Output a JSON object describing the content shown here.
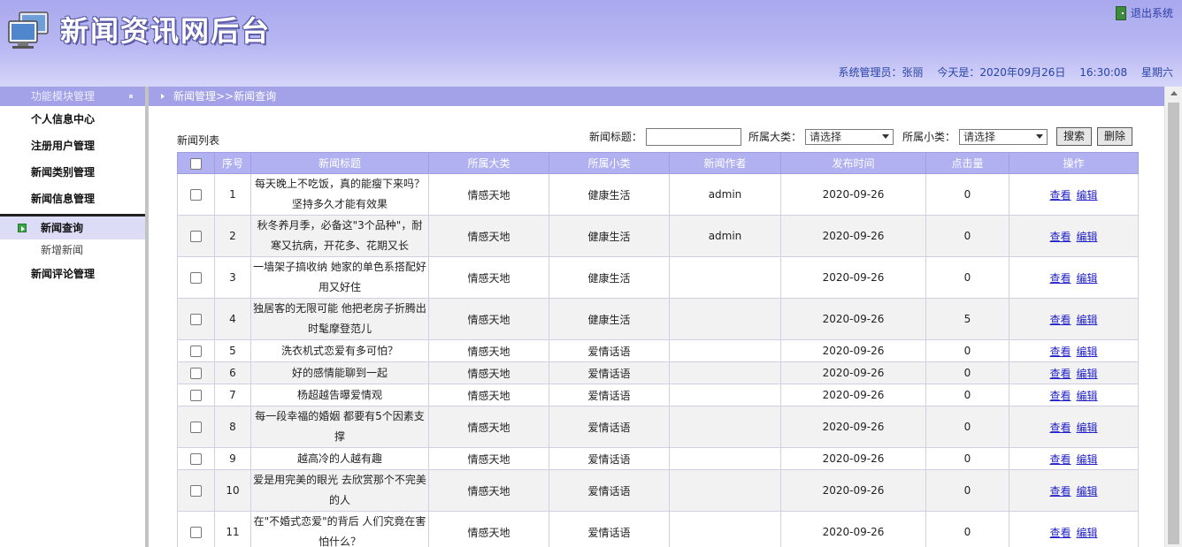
{
  "header": {
    "site_title": "新闻资讯网后台",
    "logout_label": "退出系统",
    "admin_label": "系统管理员：张丽",
    "date_label": "今天是：2020年09月26日",
    "time_label": "16:30:08",
    "weekday_label": "星期六"
  },
  "sidebar": {
    "heading": "功能模块管理",
    "items": [
      {
        "label": "个人信息中心"
      },
      {
        "label": "注册用户管理"
      },
      {
        "label": "新闻类别管理"
      },
      {
        "label": "新闻信息管理"
      }
    ],
    "active_item": "新闻查询",
    "sub_item": "新增新闻",
    "last_item": "新闻评论管理"
  },
  "breadcrumb": "新闻管理>>新闻查询",
  "list": {
    "title": "新闻列表",
    "search_title_label": "新闻标题：",
    "category_label": "所属大类：",
    "category_value": "请选择",
    "subcategory_label": "所属小类：",
    "subcategory_value": "请选择",
    "search_button": "搜索",
    "delete_button": "删除"
  },
  "table": {
    "headers": [
      "序号",
      "新闻标题",
      "所属大类",
      "所属小类",
      "新闻作者",
      "发布时间",
      "点击量",
      "操作"
    ],
    "view_label": "查看",
    "edit_label": "编辑",
    "rows": [
      {
        "no": "1",
        "title": "每天晚上不吃饭，真的能瘦下来吗？坚持多久才能有效果",
        "cat": "情感天地",
        "sub": "健康生活",
        "author": "admin",
        "date": "2020-09-26",
        "hits": "0"
      },
      {
        "no": "2",
        "title": "秋冬养月季，必备这\"3个品种\"，耐寒又抗病，开花多、花期又长",
        "cat": "情感天地",
        "sub": "健康生活",
        "author": "admin",
        "date": "2020-09-26",
        "hits": "0"
      },
      {
        "no": "3",
        "title": "一墙架子搞收纳 她家的单色系搭配好用又好住",
        "cat": "情感天地",
        "sub": "健康生活",
        "author": "",
        "date": "2020-09-26",
        "hits": "0"
      },
      {
        "no": "4",
        "title": "独居客的无限可能 他把老房子折腾出时髦摩登范儿",
        "cat": "情感天地",
        "sub": "健康生活",
        "author": "",
        "date": "2020-09-26",
        "hits": "5"
      },
      {
        "no": "5",
        "title": "洗衣机式恋爱有多可怕？",
        "cat": "情感天地",
        "sub": "爱情话语",
        "author": "",
        "date": "2020-09-26",
        "hits": "0"
      },
      {
        "no": "6",
        "title": "好的感情能聊到一起",
        "cat": "情感天地",
        "sub": "爱情话语",
        "author": "",
        "date": "2020-09-26",
        "hits": "0"
      },
      {
        "no": "7",
        "title": "杨超越告曝爱情观",
        "cat": "情感天地",
        "sub": "爱情话语",
        "author": "",
        "date": "2020-09-26",
        "hits": "0"
      },
      {
        "no": "8",
        "title": "每一段幸福的婚姻 都要有5个因素支撑",
        "cat": "情感天地",
        "sub": "爱情话语",
        "author": "",
        "date": "2020-09-26",
        "hits": "0"
      },
      {
        "no": "9",
        "title": "越高冷的人越有趣",
        "cat": "情感天地",
        "sub": "爱情话语",
        "author": "",
        "date": "2020-09-26",
        "hits": "0"
      },
      {
        "no": "10",
        "title": "爱是用完美的眼光 去欣赏那个不完美的人",
        "cat": "情感天地",
        "sub": "爱情话语",
        "author": "",
        "date": "2020-09-26",
        "hits": "0"
      },
      {
        "no": "11",
        "title": "在\"不婚式恋爱\"的背后 人们究竟在害怕什么？",
        "cat": "情感天地",
        "sub": "爱情话语",
        "author": "",
        "date": "2020-09-26",
        "hits": "0"
      }
    ]
  }
}
